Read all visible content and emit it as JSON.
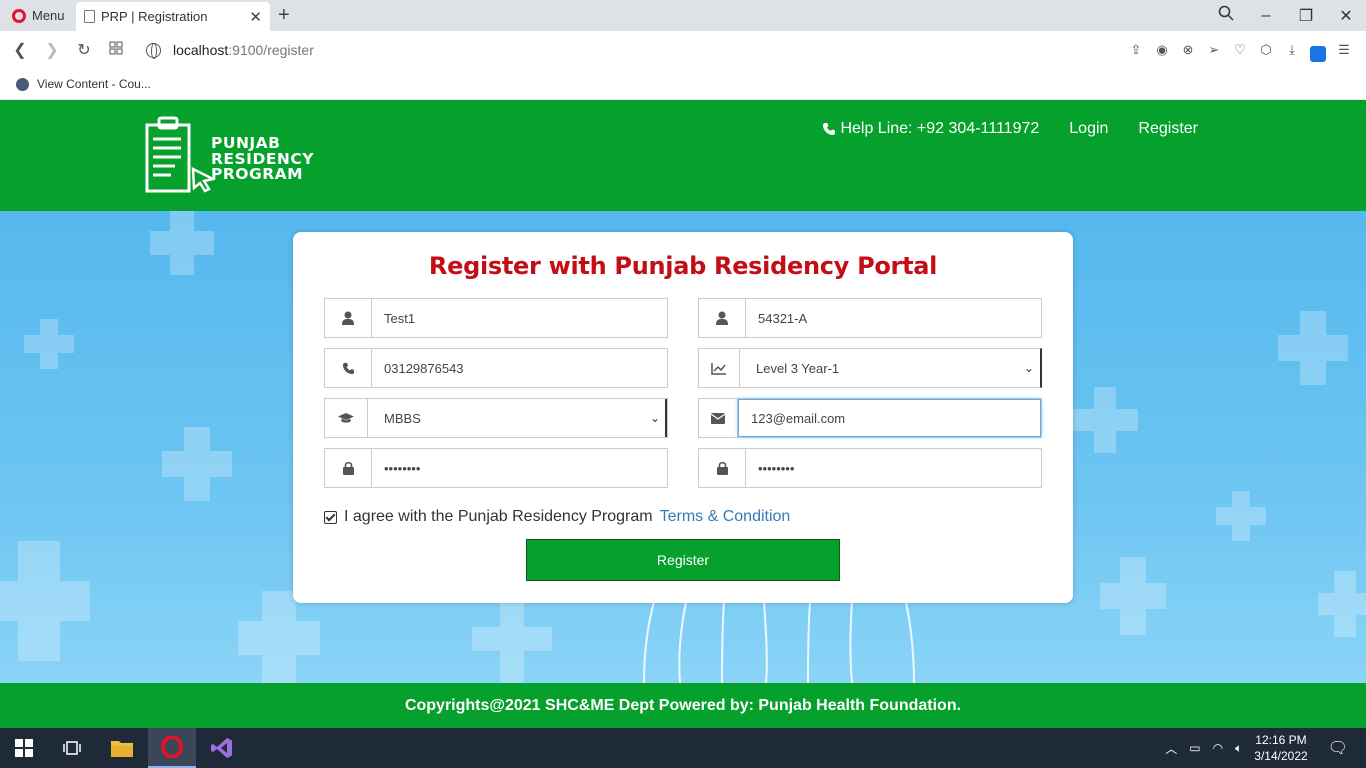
{
  "browser": {
    "menu_label": "Menu",
    "tab_title": "PRP | Registration",
    "url_host": "localhost",
    "url_rest": ":9100/register",
    "bookmark_label": "View Content - Cou..."
  },
  "header": {
    "logo_line1": "PUNJAB",
    "logo_line2": "RESIDENCY",
    "logo_line3": "PROGRAM",
    "helpline": "Help Line: +92 304-1111972",
    "login": "Login",
    "register": "Register"
  },
  "form": {
    "title": "Register with Punjab Residency Portal",
    "name_value": "Test1",
    "pmdc_value": "54321-A",
    "phone_value": "03129876543",
    "level_value": "Level 3 Year-1",
    "degree_value": "MBBS",
    "email_value": "123@email.com",
    "password_mask": "••••••••",
    "confirm_mask": "••••••••",
    "agree_text": "I agree with the Punjab Residency Program",
    "terms_link": "Terms & Condition",
    "agree_checked": true,
    "submit_label": "Register"
  },
  "footer": {
    "text": "Copyrights@2021 SHC&ME Dept Powered by: Punjab Health Foundation."
  },
  "taskbar": {
    "time": "12:16 PM",
    "date": "3/14/2022"
  },
  "colors": {
    "brand_green": "#06a02c",
    "title_red": "#c30d17",
    "link_blue": "#337ab7"
  },
  "icons": [
    "user-icon",
    "phone-icon",
    "chart-icon",
    "graduation-cap-icon",
    "envelope-icon",
    "lock-icon"
  ]
}
